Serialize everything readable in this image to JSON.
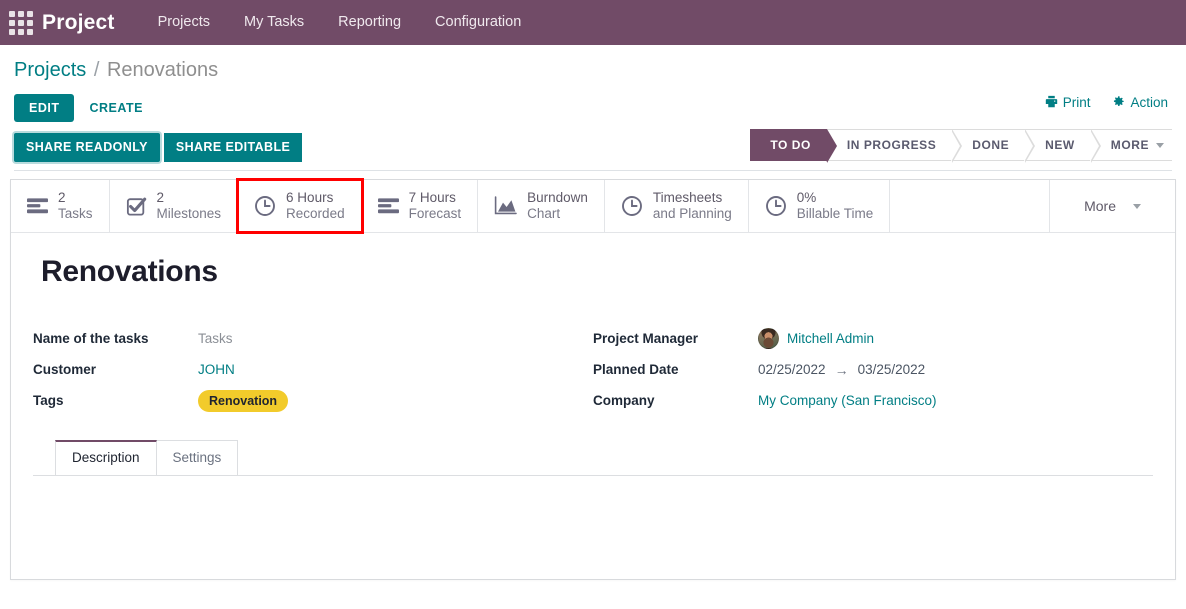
{
  "navbar": {
    "apps_icon": "apps-grid-icon",
    "brand": "Project",
    "menu": [
      {
        "label": "Projects"
      },
      {
        "label": "My Tasks"
      },
      {
        "label": "Reporting"
      },
      {
        "label": "Configuration"
      }
    ]
  },
  "breadcrumb": {
    "root": "Projects",
    "separator": "/",
    "current": "Renovations"
  },
  "control_panel": {
    "edit_label": "EDIT",
    "create_label": "CREATE",
    "print_label": "Print",
    "print_icon": "printer-icon",
    "action_label": "Action",
    "action_icon": "gear-icon"
  },
  "share": {
    "readonly_label": "SHARE READONLY",
    "editable_label": "SHARE EDITABLE"
  },
  "statusbar": {
    "stages": [
      {
        "label": "TO DO",
        "active": true
      },
      {
        "label": "IN PROGRESS",
        "active": false
      },
      {
        "label": "DONE",
        "active": false
      },
      {
        "label": "NEW",
        "active": false
      },
      {
        "label": "MORE",
        "active": false,
        "has_caret": true
      }
    ]
  },
  "stat_buttons": [
    {
      "value": "2",
      "label": "Tasks",
      "icon": "list-bars-icon",
      "highlighted": false
    },
    {
      "value": "2",
      "label": "Milestones",
      "icon": "check-square-icon",
      "highlighted": false
    },
    {
      "value": "6 Hours",
      "label": "Recorded",
      "icon": "clock-icon",
      "highlighted": true
    },
    {
      "value": "7 Hours",
      "label": "Forecast",
      "icon": "list-bars-icon",
      "highlighted": false
    },
    {
      "value": "Burndown",
      "label": "Chart",
      "icon": "area-chart-icon",
      "highlighted": false
    },
    {
      "value": "Timesheets",
      "label": "and Planning",
      "icon": "clock-icon",
      "highlighted": false
    },
    {
      "value": "0%",
      "label": "Billable Time",
      "icon": "clock-icon",
      "highlighted": false
    }
  ],
  "more_button": {
    "label": "More",
    "caret_icon": "chevron-down-icon"
  },
  "record": {
    "title": "Renovations",
    "left_fields": [
      {
        "label": "Name of the tasks",
        "value": "Tasks",
        "style": "muted"
      },
      {
        "label": "Customer",
        "value": "JOHN",
        "style": "link"
      },
      {
        "label": "Tags",
        "value": "Renovation",
        "style": "tag"
      }
    ],
    "right_fields": [
      {
        "label": "Project Manager",
        "value": "Mitchell Admin",
        "style": "avatar"
      },
      {
        "label": "Planned Date",
        "value": "02/25/2022",
        "value2": "03/25/2022",
        "arrow": "→",
        "style": "daterange"
      },
      {
        "label": "Company",
        "value": "My Company (San Francisco)",
        "style": "link"
      }
    ]
  },
  "notebook": {
    "tabs": [
      {
        "label": "Description",
        "active": true
      },
      {
        "label": "Settings",
        "active": false
      }
    ],
    "body_text": ""
  },
  "colors": {
    "brand_purple": "#714B67",
    "accent_teal": "#017E84",
    "tag_yellow": "#F2CB2B",
    "highlight_red": "#ff0000"
  }
}
